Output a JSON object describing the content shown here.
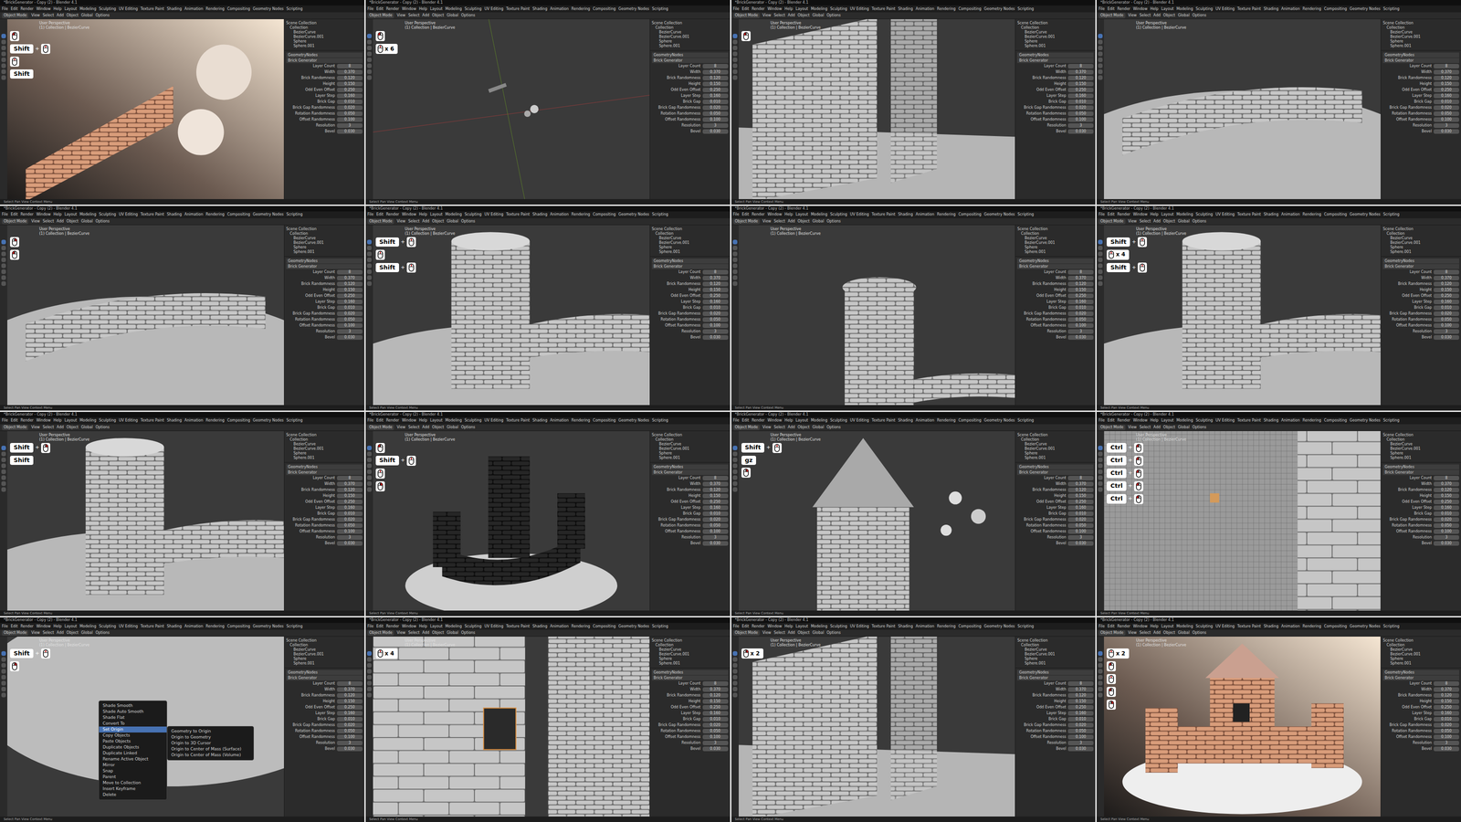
{
  "window": {
    "title": "*BrickGenerator - Copy (2) - Blender 4.1"
  },
  "menu": [
    "File",
    "Edit",
    "Render",
    "Window",
    "Help",
    "Layout",
    "Modeling",
    "Sculpting",
    "UV Editing",
    "Texture Paint",
    "Shading",
    "Animation",
    "Rendering",
    "Compositing",
    "Geometry Nodes",
    "Scripting"
  ],
  "editor_header": [
    "Object Mode",
    "View",
    "Select",
    "Add",
    "Object",
    "Global",
    "Options"
  ],
  "viewport_label": {
    "title": "User Perspective",
    "subtitle": "(1) Collection | BezierCurve"
  },
  "plus": "+",
  "outliner": [
    "Scene Collection",
    "Collection",
    "BezierCurve",
    "BezierCurve.001",
    "Sphere",
    "Sphere.001"
  ],
  "modifier": {
    "name": "Brick Generator",
    "group": "GeometryNodes"
  },
  "properties": [
    {
      "label": "Layer Count",
      "value": "8"
    },
    {
      "label": "Width",
      "value": "0.370"
    },
    {
      "label": "Brick Randomness",
      "value": "0.120"
    },
    {
      "label": "Height",
      "value": "0.150"
    },
    {
      "label": "Odd Even Offset",
      "value": "0.250"
    },
    {
      "label": "Layer Step",
      "value": "0.160"
    },
    {
      "label": "Brick Gap",
      "value": "0.010"
    },
    {
      "label": "Brick Gap Randomness",
      "value": "0.020"
    },
    {
      "label": "Rotation Randomness",
      "value": "0.050"
    },
    {
      "label": "Offset Randomness",
      "value": "0.100"
    },
    {
      "label": "Resolution",
      "value": "3"
    },
    {
      "label": "Bevel",
      "value": "0.030"
    }
  ],
  "status_bar": "Select   Pan View   Context Menu",
  "context_menu": {
    "items": [
      {
        "label": "Shade Smooth",
        "selected": false
      },
      {
        "label": "Shade Auto Smooth",
        "selected": false
      },
      {
        "label": "Shade Flat",
        "selected": false
      },
      {
        "label": "Convert To",
        "selected": false
      },
      {
        "label": "Set Origin",
        "selected": true
      },
      {
        "label": "Copy Objects",
        "selected": false
      },
      {
        "label": "Paste Objects",
        "selected": false
      },
      {
        "label": "Duplicate Objects",
        "selected": false
      },
      {
        "label": "Duplicate Linked",
        "selected": false
      },
      {
        "label": "Rename Active Object",
        "selected": false
      },
      {
        "label": "Mirror",
        "selected": false
      },
      {
        "label": "Snap",
        "selected": false
      },
      {
        "label": "Parent",
        "selected": false
      },
      {
        "label": "Move to Collection",
        "selected": false
      },
      {
        "label": "Insert Keyframe",
        "selected": false
      },
      {
        "label": "Delete",
        "selected": false
      }
    ],
    "submenu": [
      "Geometry to Origin",
      "Origin to Geometry",
      "Origin to 3D Cursor",
      "Origin to Center of Mass (Surface)",
      "Origin to Center of Mass (Volume)"
    ]
  },
  "frames": [
    {
      "scene": "render",
      "menu_open": false,
      "keys": [
        {
          "key": "",
          "mouse": true,
          "button": "left",
          "count": ""
        },
        {
          "key": "Shift",
          "mouse": true,
          "button": "wheel",
          "count": ""
        },
        {
          "key": "",
          "mouse": true,
          "button": "wheel",
          "count": ""
        },
        {
          "key": "Shift",
          "mouse": false,
          "button": "",
          "count": ""
        }
      ]
    },
    {
      "scene": "empty",
      "menu_open": false,
      "keys": [
        {
          "key": "",
          "mouse": true,
          "button": "left",
          "count": ""
        },
        {
          "key": "",
          "mouse": true,
          "button": "wheel",
          "count": "x 6"
        }
      ]
    },
    {
      "scene": "wall",
      "menu_open": false,
      "keys": [
        {
          "key": "",
          "mouse": true,
          "button": "left",
          "count": ""
        }
      ]
    },
    {
      "scene": "curved-wall",
      "menu_open": false,
      "keys": []
    },
    {
      "scene": "curved-wall",
      "menu_open": false,
      "keys": [
        {
          "key": "",
          "mouse": true,
          "button": "right",
          "count": ""
        },
        {
          "key": "",
          "mouse": true,
          "button": "left",
          "count": ""
        }
      ]
    },
    {
      "scene": "tower",
      "menu_open": false,
      "keys": [
        {
          "key": "Shift",
          "mouse": true,
          "button": "wheel",
          "count": ""
        },
        {
          "key": "",
          "mouse": true,
          "button": "wheel",
          "count": ""
        },
        {
          "key": "Shift",
          "mouse": true,
          "button": "wheel",
          "count": ""
        }
      ]
    },
    {
      "scene": "tower-top",
      "menu_open": false,
      "keys": []
    },
    {
      "scene": "tower",
      "menu_open": false,
      "keys": [
        {
          "key": "Shift",
          "mouse": true,
          "button": "wheel",
          "count": ""
        },
        {
          "key": "",
          "mouse": true,
          "button": "wheel",
          "count": "x 4"
        },
        {
          "key": "Shift",
          "mouse": true,
          "button": "wheel",
          "count": ""
        }
      ]
    },
    {
      "scene": "tower",
      "menu_open": false,
      "keys": [
        {
          "key": "Shift",
          "mouse": true,
          "button": "right",
          "count": ""
        },
        {
          "key": "Shift",
          "mouse": false,
          "button": "",
          "count": ""
        }
      ]
    },
    {
      "scene": "dark-towers",
      "menu_open": false,
      "keys": [
        {
          "key": "",
          "mouse": true,
          "button": "left",
          "count": ""
        },
        {
          "key": "Shift",
          "mouse": true,
          "button": "wheel",
          "count": ""
        },
        {
          "key": "",
          "mouse": true,
          "button": "wheel",
          "count": ""
        },
        {
          "key": "",
          "mouse": true,
          "button": "right",
          "count": ""
        }
      ]
    },
    {
      "scene": "cone",
      "menu_open": false,
      "keys": [
        {
          "key": "Shift",
          "mouse": true,
          "button": "wheel",
          "count": ""
        },
        {
          "key": "gz",
          "mouse": false,
          "button": "",
          "count": ""
        },
        {
          "key": "",
          "mouse": true,
          "button": "right",
          "count": ""
        }
      ]
    },
    {
      "scene": "mesh",
      "menu_open": false,
      "keys": [
        {
          "key": "Ctrl",
          "mouse": true,
          "button": "left",
          "count": ""
        },
        {
          "key": "Ctrl",
          "mouse": true,
          "button": "left",
          "count": ""
        },
        {
          "key": "Ctrl",
          "mouse": true,
          "button": "left",
          "count": ""
        },
        {
          "key": "Ctrl",
          "mouse": true,
          "button": "left",
          "count": ""
        },
        {
          "key": "Ctrl",
          "mouse": true,
          "button": "left",
          "count": ""
        }
      ]
    },
    {
      "scene": "floor",
      "menu_open": true,
      "keys": [
        {
          "key": "Shift",
          "mouse": true,
          "button": "wheel",
          "count": ""
        },
        {
          "key": "",
          "mouse": true,
          "button": "right",
          "count": ""
        }
      ]
    },
    {
      "scene": "closeup",
      "menu_open": false,
      "keys": [
        {
          "key": "",
          "mouse": true,
          "button": "wheel",
          "count": "x 4"
        }
      ]
    },
    {
      "scene": "wall",
      "menu_open": false,
      "keys": [
        {
          "key": "",
          "mouse": true,
          "button": "right",
          "count": "x 2"
        }
      ]
    },
    {
      "scene": "castle-render",
      "menu_open": false,
      "keys": [
        {
          "key": "",
          "mouse": true,
          "button": "wheel",
          "count": "x 2"
        },
        {
          "key": "",
          "mouse": true,
          "button": "left",
          "count": ""
        },
        {
          "key": "",
          "mouse": true,
          "button": "wheel",
          "count": ""
        },
        {
          "key": "",
          "mouse": true,
          "button": "left",
          "count": ""
        },
        {
          "key": "",
          "mouse": true,
          "button": "right",
          "count": ""
        }
      ]
    }
  ]
}
